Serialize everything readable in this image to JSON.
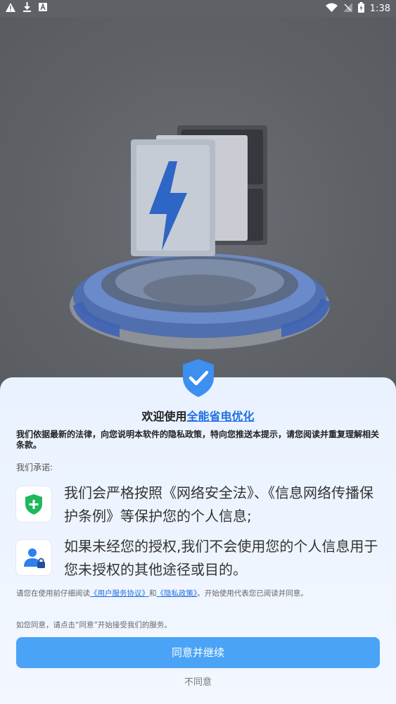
{
  "status_bar": {
    "time": "1:38"
  },
  "dialog": {
    "title_prefix": "欢迎使用",
    "app_name": "全能省电优化",
    "intro": "我们依据最新的法律，向您说明本软件的隐私政策，特向您推送本提示，请您阅读并重复理解相关条款。",
    "promise_label": "我们承诺:",
    "items": [
      {
        "icon": "shield-plus-icon",
        "text": "我们会严格按照《网络安全法》、《信息网络传播保护条例》等保护您的个人信息;"
      },
      {
        "icon": "user-lock-icon",
        "text": "如果未经您的授权,我们不会使用您的个人信息用于您未授权的其他途径或目的。"
      }
    ],
    "notice_prefix": "请您在使用前仔细阅读",
    "service_link": "《用户服务协议》",
    "notice_and": "和",
    "privacy_link": "《隐私政策》",
    "notice_suffix": "。开始使用代表您已阅读并同意。",
    "consent_hint": "如您同意，请点击“同意”开始接受我们的服务。",
    "agree_label": "同意并继续",
    "disagree_label": "不同意"
  },
  "colors": {
    "accent": "#4aa3f6",
    "link": "#1f6fe0"
  }
}
